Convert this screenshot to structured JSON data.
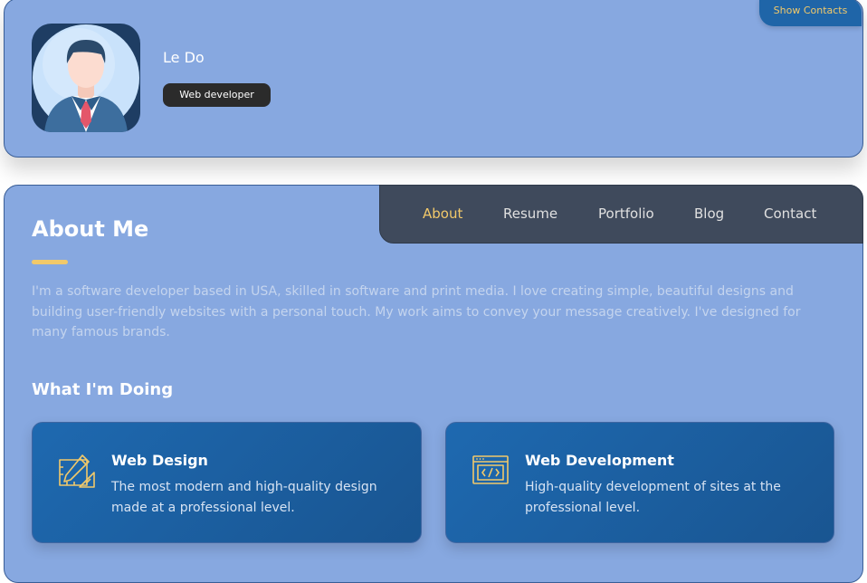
{
  "profile": {
    "name": "Le Do",
    "role": "Web developer",
    "show_contacts_label": "Show Contacts"
  },
  "navigation": {
    "items": [
      {
        "label": "About",
        "active": true
      },
      {
        "label": "Resume",
        "active": false
      },
      {
        "label": "Portfolio",
        "active": false
      },
      {
        "label": "Blog",
        "active": false
      },
      {
        "label": "Contact",
        "active": false
      }
    ]
  },
  "about": {
    "title": "About Me",
    "text": "I'm a software developer based in USA, skilled in software and print media. I love creating simple, beautiful designs and building user-friendly websites with a personal touch. My work aims to convey your message creatively. I've designed for many famous brands."
  },
  "doing": {
    "title": "What I'm Doing",
    "services": [
      {
        "icon": "design-tools-icon",
        "title": "Web Design",
        "description": "The most modern and high-quality design made at a professional level."
      },
      {
        "icon": "code-window-icon",
        "title": "Web Development",
        "description": "High-quality development of sites at the professional level."
      }
    ]
  },
  "colors": {
    "card_background": "#87a8e0",
    "accent": "#f2c96a",
    "nav_background": "#3f4a5c",
    "service_card": "#1e69b0",
    "badge_background": "#2b2b2b"
  }
}
